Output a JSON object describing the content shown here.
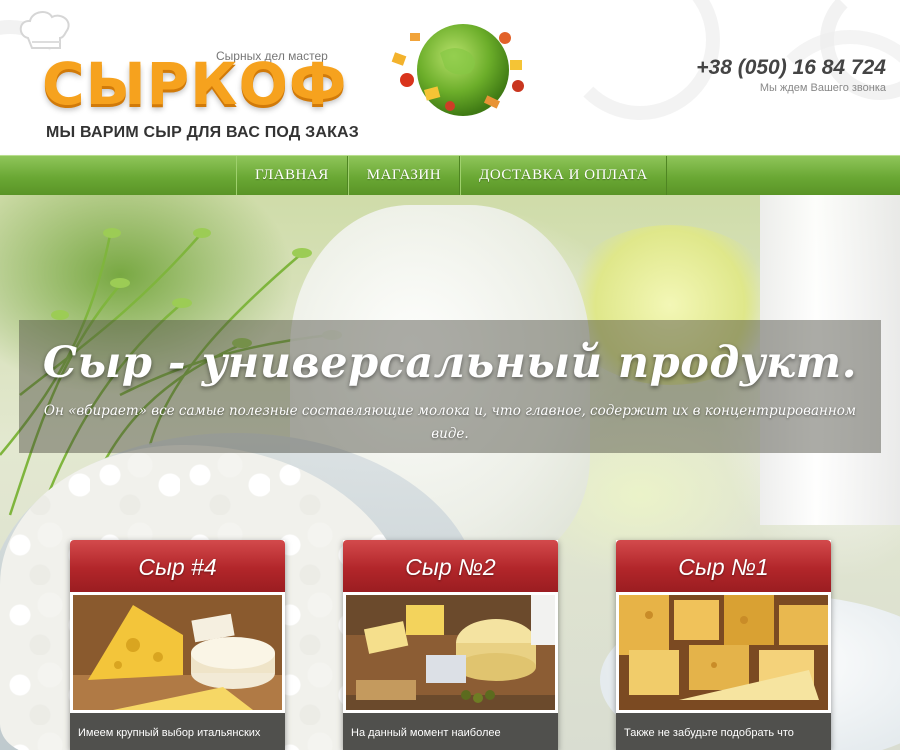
{
  "header": {
    "tagline_small": "Сырных дел мастер",
    "logo_text": "СЫРКОФ",
    "slogan": "МЫ ВАРИМ СЫР ДЛЯ ВАС ПОД ЗАКАЗ",
    "phone": "+38 (050) 16 84 724",
    "phone_note": "Мы ждем Вашего звонка"
  },
  "nav": {
    "items": [
      {
        "label": "ГЛАВНАЯ"
      },
      {
        "label": "МАГАЗИН"
      },
      {
        "label": "ДОСТАВКА И ОПЛАТА"
      }
    ]
  },
  "hero": {
    "title": "Сыр - универсальный продукт.",
    "text": "Он «вбирает» все самые полезные составляющие молока и, что главное, содержит их в концентрированном виде."
  },
  "products": [
    {
      "title": "Сыр #4",
      "text": "Имеем крупный выбор итальянских"
    },
    {
      "title": "Сыр №2",
      "text": "На данный момент наиболее"
    },
    {
      "title": "Сыр №1",
      "text": "Также не забудьте подобрать что"
    }
  ],
  "colors": {
    "nav_green": "#6aa834",
    "card_red": "#b2262a",
    "logo_orange": "#f6a21e"
  }
}
